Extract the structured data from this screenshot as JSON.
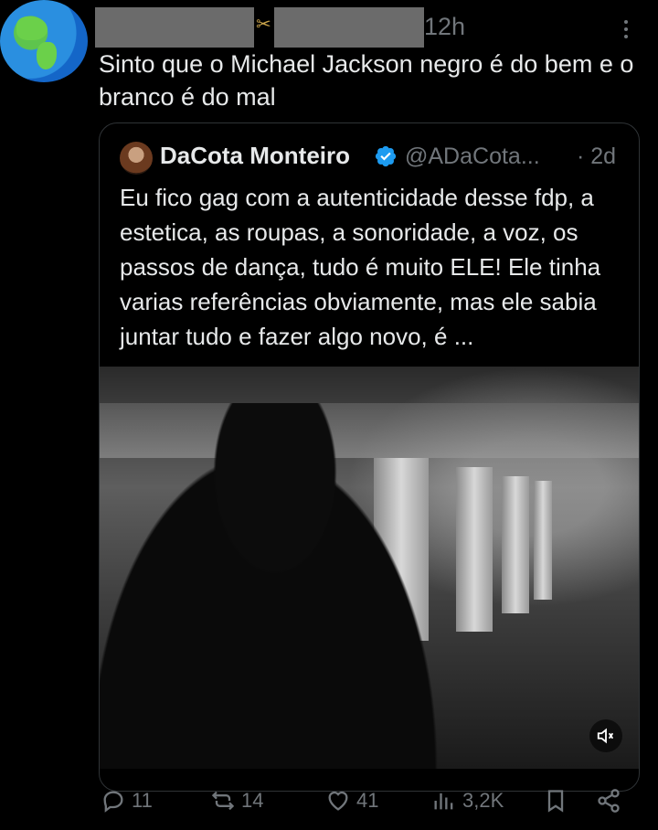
{
  "post": {
    "time": "12h",
    "text": "Sinto que o Michael Jackson negro é do bem e o branco é do mal"
  },
  "quoted": {
    "name": "DaCota Monteiro",
    "handle": "@ADaCota...",
    "time": "· 2d",
    "text": "Eu fico gag com a autenticidade desse fdp, a estetica, as roupas, a sonoridade, a voz, os passos de dança, tudo é muito ELE! Ele tinha varias referências obviamente, mas ele sabia juntar tudo e fazer algo novo, é ..."
  },
  "actions": {
    "replies": "11",
    "reposts": "14",
    "likes": "41",
    "views": "3,2K"
  },
  "icons": [
    "more-icon",
    "verified-icon",
    "mute-icon",
    "reply-icon",
    "repost-icon",
    "like-icon",
    "views-icon",
    "bookmark-icon",
    "share-icon"
  ],
  "colors": {
    "background": "#000000",
    "text": "#e7e9ea",
    "muted": "#71767b",
    "verified": "#1d9bf0",
    "border": "#2f3336"
  }
}
